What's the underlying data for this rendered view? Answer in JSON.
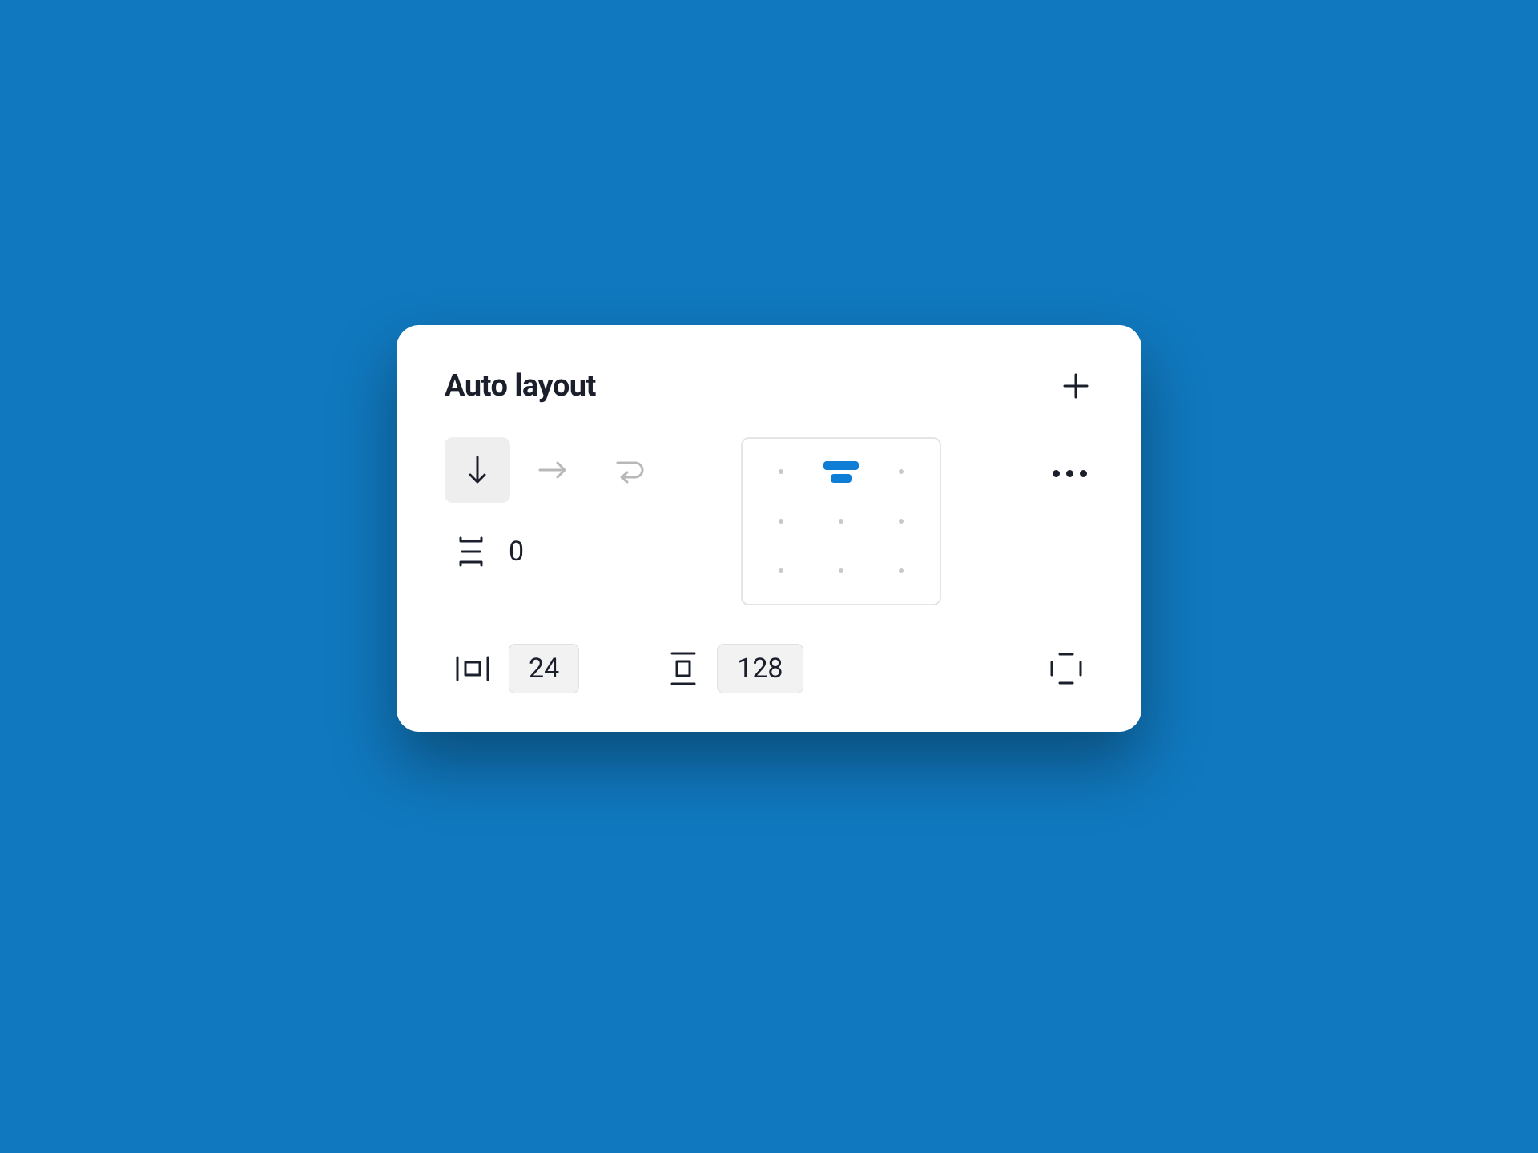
{
  "panel": {
    "title": "Auto layout",
    "gap_value": "0",
    "horizontal_padding": "24",
    "vertical_padding": "128",
    "direction_selected": "vertical",
    "alignment": "top-center",
    "colors": {
      "accent": "#0d7dd6",
      "background": "#1078BE"
    },
    "icons": {
      "add": "plus-icon",
      "direction_vertical": "arrow-down-icon",
      "direction_horizontal": "arrow-right-icon",
      "direction_wrap": "wrap-icon",
      "gap": "gap-spacing-icon",
      "horizontal_padding": "horizontal-padding-icon",
      "vertical_padding": "vertical-padding-icon",
      "individual_padding": "individual-padding-icon",
      "more": "more-options-icon"
    }
  }
}
